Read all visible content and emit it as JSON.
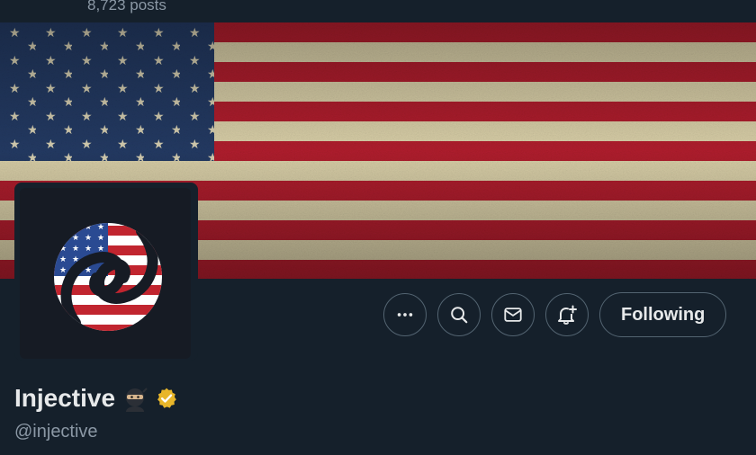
{
  "header": {
    "post_count": "8,723 posts"
  },
  "profile": {
    "display_name": "Injective",
    "handle": "@injective",
    "verified": true,
    "badge_color": "#e8b62a"
  },
  "actions": {
    "more_icon": "more-horizontal-icon",
    "search_icon": "search-icon",
    "message_icon": "mail-icon",
    "notify_icon": "bell-plus-icon",
    "follow_label": "Following"
  },
  "colors": {
    "background": "#15202b",
    "flag_red": "#b01c2e",
    "flag_blue": "#223a63",
    "border": "#536471"
  }
}
